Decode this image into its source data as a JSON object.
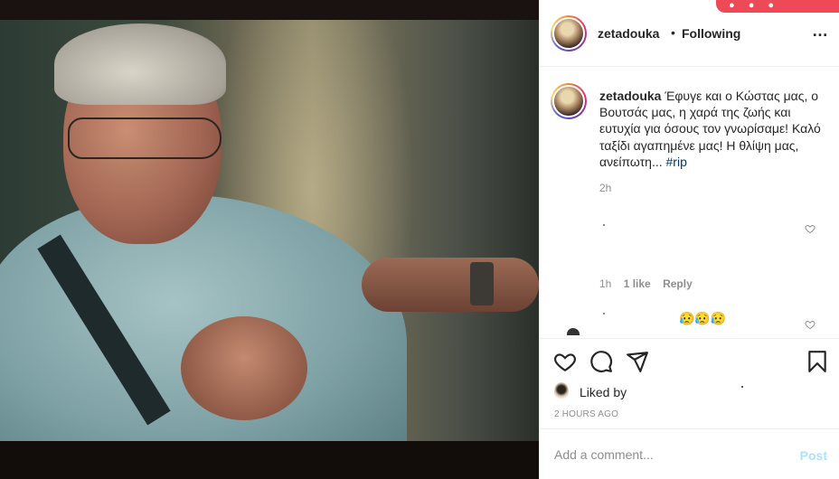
{
  "post": {
    "author": "zetadouka",
    "separator": "•",
    "follow_status": "Following",
    "more_icon": "…"
  },
  "caption": {
    "username": "zetadouka",
    "text": " Έφυγε και ο Κώστας μας, ο Βουτσάς μας, η χαρά της ζωής και ευτυχία για όσους τον γνωρίσαμε! Καλό ταξίδι αγαπημένε μας! Η θλίψη μας, ανείπωτη... ",
    "hashtag": "#rip",
    "time": "2h"
  },
  "comments": [
    {
      "text": "",
      "time": "1h",
      "likes": "1 like",
      "reply": "Reply"
    },
    {
      "text": "😥😥😥"
    }
  ],
  "actions": {
    "like_icon": "heart-icon",
    "comment_icon": "comment-icon",
    "share_icon": "paper-plane-icon",
    "save_icon": "bookmark-icon"
  },
  "likes": {
    "label": "Liked by"
  },
  "timestamp": "2 HOURS AGO",
  "add_comment": {
    "placeholder": "Add a comment...",
    "post_label": "Post"
  },
  "colors": {
    "text": "#262626",
    "muted": "#8e8e8e",
    "hashtag": "#00376b",
    "post_disabled": "#b2dffc",
    "notification": "#ed4956"
  }
}
